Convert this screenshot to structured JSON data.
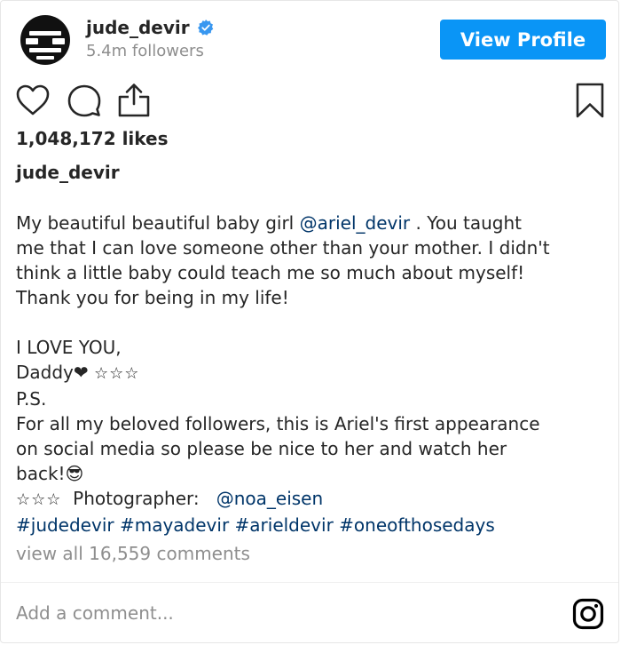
{
  "header": {
    "username": "jude_devir",
    "followers": "5.4m followers",
    "view_profile_label": "View Profile",
    "verified_color": "#3897f0"
  },
  "icons": [
    "heart-icon",
    "comment-icon",
    "share-icon",
    "bookmark-icon",
    "instagram-logo-icon"
  ],
  "likes": "1,048,172 likes",
  "caption": {
    "username": "jude_devir",
    "line1_text": "My beautiful beautiful baby girl ",
    "line1_mention": "@ariel_devir",
    "line1_tail": " . You taught",
    "line2": "me that I can love someone other than your mother. I didn't",
    "line3": "think a little baby could teach me so much about myself!",
    "line4": "Thank you for being in my life!",
    "line6": "I LOVE YOU,",
    "line7_text": "Daddy❤ ",
    "stars": "☆☆☆",
    "line8": "P.S.",
    "line9": "For all my beloved followers, this is Ariel's first appearance",
    "line10": "on social media so please be nice to her and watch her",
    "line11": "back!😎",
    "line12_text": "  Photographer:   ",
    "line12_mention": "@noa_eisen",
    "hashtags": [
      "#judedevir",
      "#mayadevir",
      "#arieldevir",
      "#oneofthosedays"
    ]
  },
  "comments_link": "view all 16,559 comments",
  "comment_input": {
    "placeholder": "Add a comment..."
  },
  "colors": {
    "accent": "#0a95f6",
    "link": "#003569",
    "muted": "#8e8e8e",
    "text": "#262626"
  }
}
